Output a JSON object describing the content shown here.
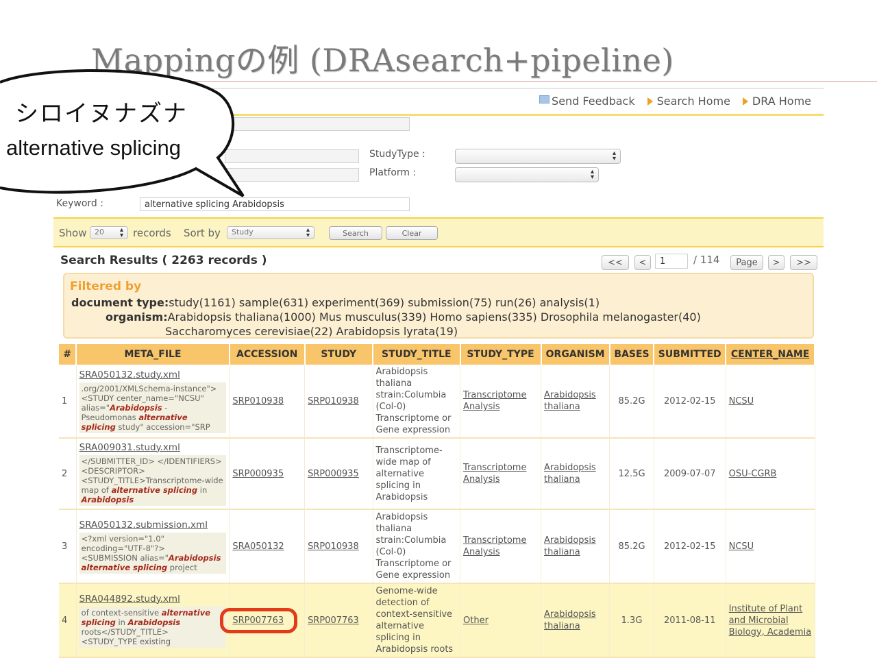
{
  "slide": {
    "title": "Mappingの例 (DRAsearch+pipeline)"
  },
  "bubble": {
    "line1": "シロイヌナズナ",
    "line2": "alternative splicing"
  },
  "toplinks": {
    "feedback": "Send Feedback",
    "search_home": "Search Home",
    "dra_home": "DRA Home"
  },
  "form": {
    "studytype_label": "StudyType :",
    "platform_label": "Platform :",
    "keyword_label": "Keyword :",
    "keyword_value": "alternative splicing Arabidopsis"
  },
  "toolbar": {
    "show_label": "Show",
    "show_value": "20",
    "records_label": "records",
    "sort_label": "Sort by",
    "sort_value": "Study",
    "search_button": "Search",
    "clear_button": "Clear"
  },
  "results": {
    "title": "Search Results ( 2263 records )",
    "pager": {
      "first": "<<",
      "prev": "<",
      "page_value": "1",
      "total": "/ 114",
      "page_button": "Page",
      "next": ">",
      "last": ">>"
    }
  },
  "filter": {
    "title": "Filtered by",
    "doc_label": "document type:",
    "doc_values": "study(1161)  sample(631)  experiment(369)  submission(75)  run(26)  analysis(1)",
    "org_label": "organism:",
    "org_values_1": "Arabidopsis thaliana(1000)  Mus musculus(339)  Homo sapiens(335)  Drosophila melanogaster(40)",
    "org_values_2": "Saccharomyces cerevisiae(22)  Arabidopsis lyrata(19)"
  },
  "columns": [
    "#",
    "META_FILE",
    "ACCESSION",
    "STUDY",
    "STUDY_TITLE",
    "STUDY_TYPE",
    "ORGANISM",
    "BASES",
    "SUBMITTED",
    "CENTER_NAME"
  ],
  "rows": [
    {
      "num": "1",
      "meta_file": "SRA050132.study.xml",
      "snippet_a": ".org/2001/XMLSchema-instance\"> <STUDY center_name=\"NCSU\" alias=\"",
      "snippet_b": "Arabidopsis",
      "snippet_c": " - Pseudomonas ",
      "snippet_d": "alternative splicing",
      "snippet_e": " study\" accession=\"SRP",
      "accession": "SRP010938",
      "study": "SRP010938",
      "title": "Arabidopsis thaliana strain:Columbia (Col-0) Transcriptome or Gene expression",
      "type": "Transcriptome Analysis",
      "organism": "Arabidopsis thaliana",
      "bases": "85.2G",
      "submitted": "2012-02-15",
      "center": "NCSU"
    },
    {
      "num": "2",
      "meta_file": "SRA009031.study.xml",
      "snippet_a": "</SUBMITTER_ID> </IDENTIFIERS> <DESCRIPTOR> <STUDY_TITLE>Transcriptome-wide map of ",
      "snippet_b": "alternative splicing",
      "snippet_c": " in ",
      "snippet_d": "Arabidopsis",
      "snippet_e": "",
      "accession": "SRP000935",
      "study": "SRP000935",
      "title": "Transcriptome-wide map of alternative splicing in Arabidopsis",
      "type": "Transcriptome Analysis",
      "organism": "Arabidopsis thaliana",
      "bases": "12.5G",
      "submitted": "2009-07-07",
      "center": "OSU-CGRB"
    },
    {
      "num": "3",
      "meta_file": "SRA050132.submission.xml",
      "snippet_a": "<?xml version=\"1.0\" encoding=\"UTF-8\"?> <SUBMISSION alias=\"",
      "snippet_b": "Arabidopsis alternative splicing",
      "snippet_c": " project",
      "snippet_d": "",
      "snippet_e": "",
      "accession": "SRA050132",
      "study": "SRP010938",
      "title": "Arabidopsis thaliana strain:Columbia (Col-0) Transcriptome or Gene expression",
      "type": "Transcriptome Analysis",
      "organism": "Arabidopsis thaliana",
      "bases": "85.2G",
      "submitted": "2012-02-15",
      "center": "NCSU"
    },
    {
      "num": "4",
      "meta_file": "SRA044892.study.xml",
      "snippet_a": "of context-sensitive ",
      "snippet_b": "alternative splicing",
      "snippet_c": " in ",
      "snippet_d": "Arabidopsis",
      "snippet_e": " roots</STUDY_TITLE> <STUDY_TYPE existing",
      "accession": "SRP007763",
      "study": "SRP007763",
      "title": "Genome-wide detection of context-sensitive alternative splicing in Arabidopsis roots",
      "type": "Other",
      "organism": "Arabidopsis thaliana",
      "bases": "1.3G",
      "submitted": "2011-08-11",
      "center": "Institute of Plant and Microbial Biology, Academia"
    }
  ],
  "colors": {
    "header": "#f8c56a",
    "highlight_row": "#fdf6c3",
    "filter_title": "#f0a030",
    "callout_ring": "#e23b18"
  }
}
